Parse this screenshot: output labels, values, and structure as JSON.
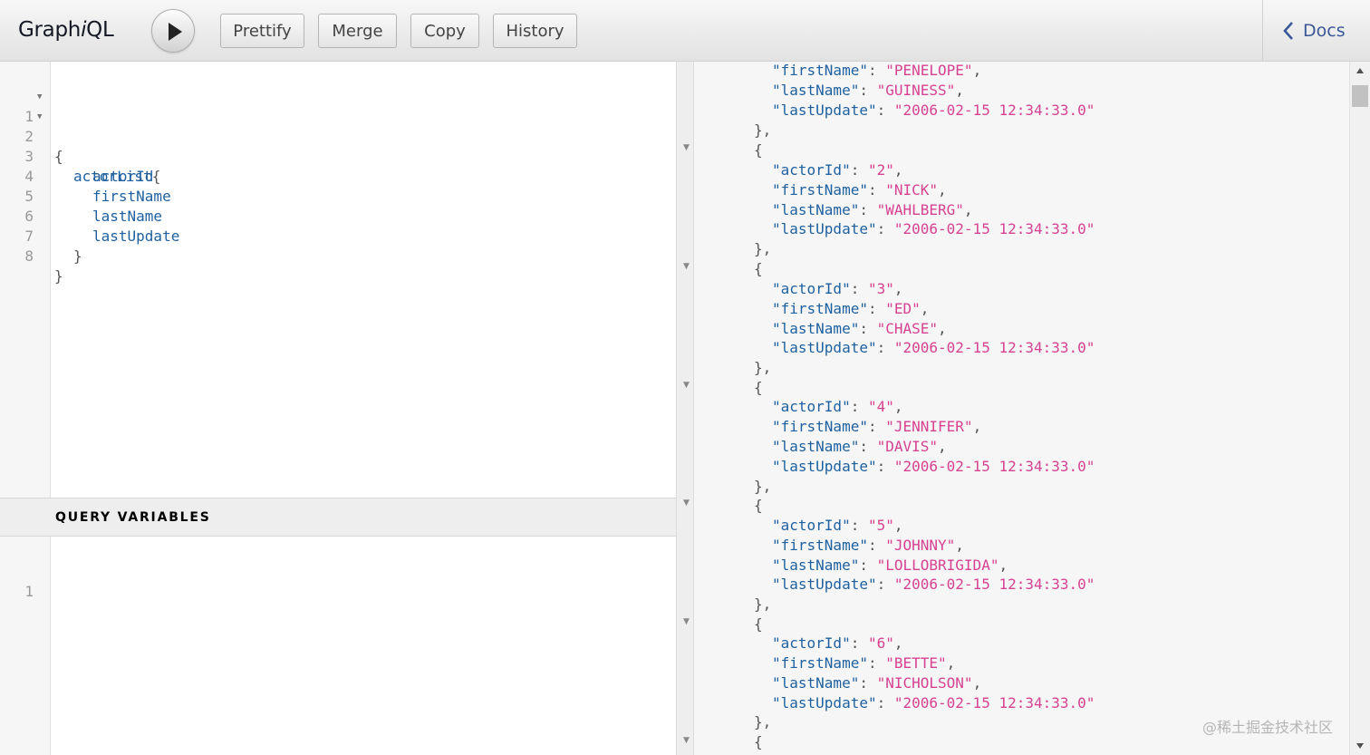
{
  "app": {
    "logo_pre": "Graph",
    "logo_i": "i",
    "logo_post": "QL"
  },
  "toolbar": {
    "run_label": "Execute query",
    "buttons": [
      "Prettify",
      "Merge",
      "Copy",
      "History"
    ],
    "docs_label": "Docs"
  },
  "query_editor": {
    "line_numbers": [
      "1",
      "2",
      "3",
      "4",
      "5",
      "6",
      "7",
      "8"
    ],
    "lines": {
      "l1": "{",
      "l2_field": "actorList",
      "l2_brace": "{",
      "l3": "actorId",
      "l4": "firstName",
      "l5": "lastName",
      "l6": "lastUpdate",
      "l7": "}",
      "l8": "}"
    }
  },
  "query_variables": {
    "header": "QUERY VARIABLES",
    "line_numbers": [
      "1"
    ]
  },
  "result": {
    "keys": {
      "actorId": "\"actorId\"",
      "firstName": "\"firstName\"",
      "lastName": "\"lastName\"",
      "lastUpdate": "\"lastUpdate\""
    },
    "open_brace": "{",
    "close_brace": "},",
    "partial_first": {
      "firstName": "\"PENELOPE\"",
      "lastName": "\"GUINESS\"",
      "lastUpdate": "\"2006-02-15 12:34:33.0\""
    },
    "actors": [
      {
        "actorId": "\"2\"",
        "firstName": "\"NICK\"",
        "lastName": "\"WAHLBERG\"",
        "lastUpdate": "\"2006-02-15 12:34:33.0\""
      },
      {
        "actorId": "\"3\"",
        "firstName": "\"ED\"",
        "lastName": "\"CHASE\"",
        "lastUpdate": "\"2006-02-15 12:34:33.0\""
      },
      {
        "actorId": "\"4\"",
        "firstName": "\"JENNIFER\"",
        "lastName": "\"DAVIS\"",
        "lastUpdate": "\"2006-02-15 12:34:33.0\""
      },
      {
        "actorId": "\"5\"",
        "firstName": "\"JOHNNY\"",
        "lastName": "\"LOLLOBRIGIDA\"",
        "lastUpdate": "\"2006-02-15 12:34:33.0\""
      },
      {
        "actorId": "\"6\"",
        "firstName": "\"BETTE\"",
        "lastName": "\"NICHOLSON\"",
        "lastUpdate": "\"2006-02-15 12:34:33.0\""
      }
    ]
  },
  "watermark": "@稀土掘金技术社区",
  "colors": {
    "field": "#1f61a0",
    "string": "#d64292",
    "docs_link": "#3b5998"
  }
}
